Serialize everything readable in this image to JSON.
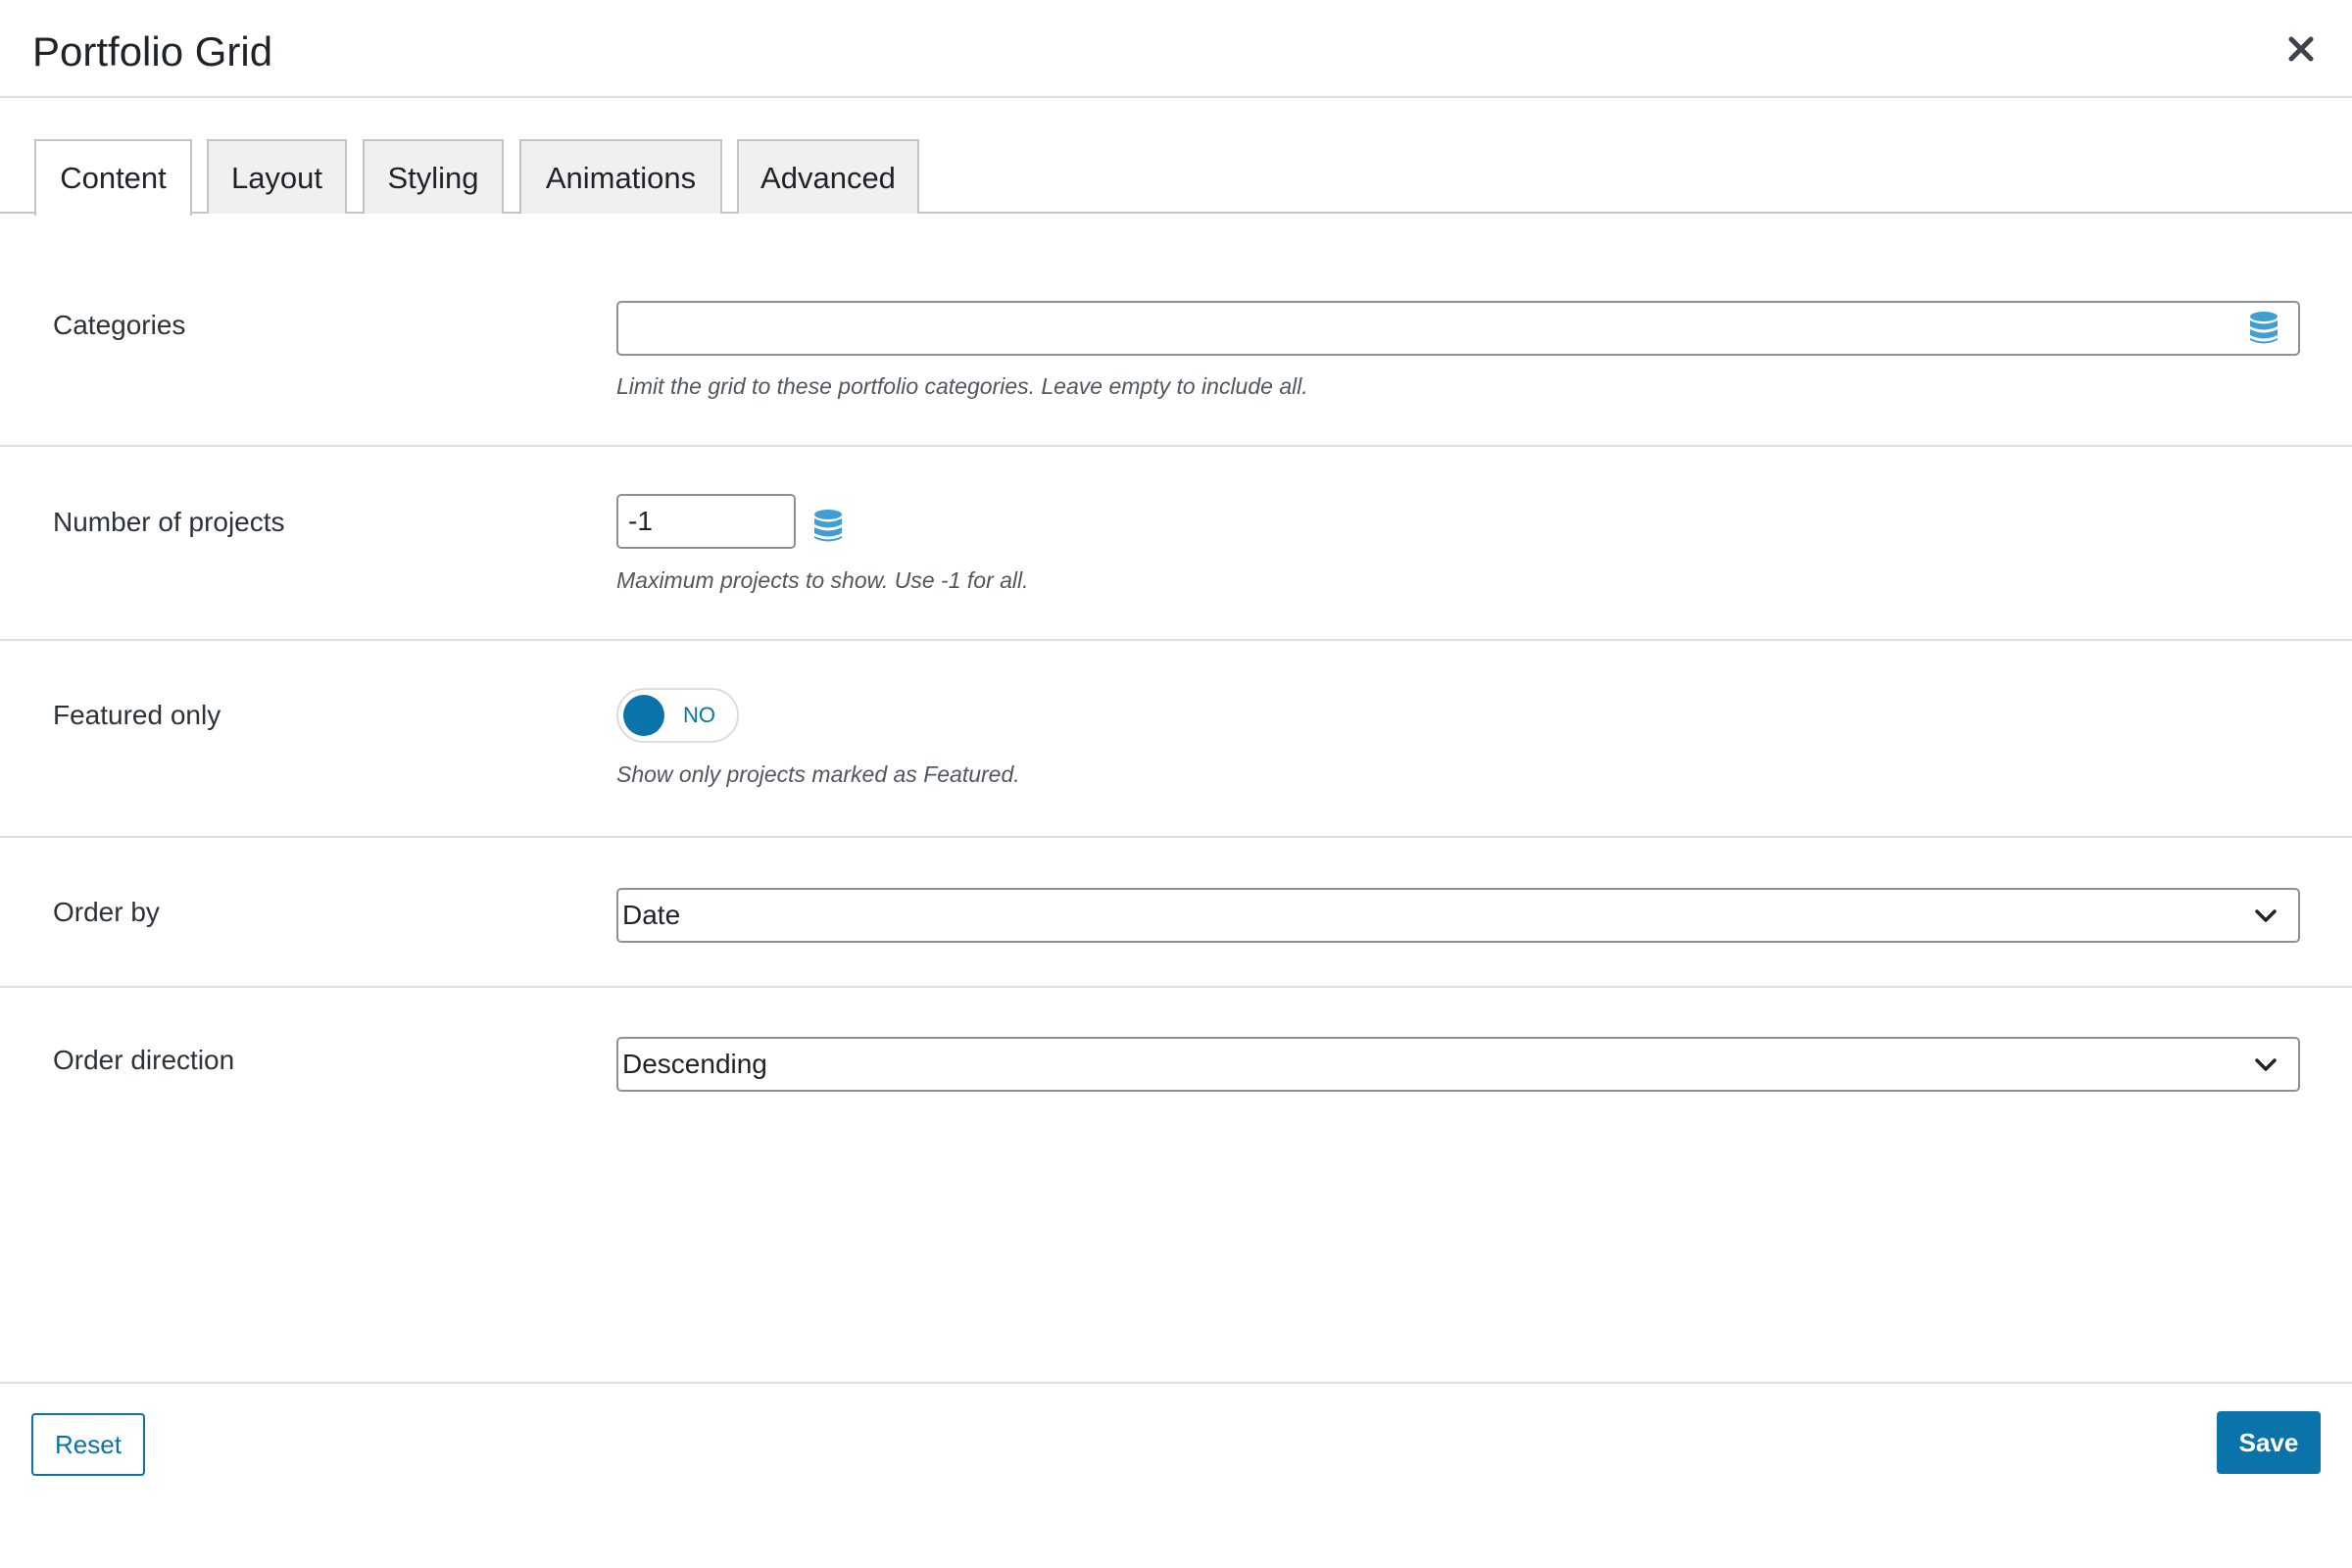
{
  "modal": {
    "title": "Portfolio Grid",
    "close_icon": "close-icon"
  },
  "tabs": [
    {
      "label": "Content",
      "active": true
    },
    {
      "label": "Layout",
      "active": false
    },
    {
      "label": "Styling",
      "active": false
    },
    {
      "label": "Animations",
      "active": false
    },
    {
      "label": "Advanced",
      "active": false
    }
  ],
  "fields": {
    "categories": {
      "label": "Categories",
      "value": "",
      "description": "Limit the grid to these portfolio categories. Leave empty to include all.",
      "icon": "database-icon"
    },
    "number_of_projects": {
      "label": "Number of projects",
      "value": "-1",
      "description": "Maximum projects to show. Use -1 for all.",
      "icon": "database-icon"
    },
    "featured_only": {
      "label": "Featured only",
      "toggle_text": "NO",
      "enabled": false,
      "description": "Show only projects marked as Featured."
    },
    "order_by": {
      "label": "Order by",
      "value": "Date",
      "icon": "chevron-down-icon"
    },
    "order_direction": {
      "label": "Order direction",
      "value": "Descending",
      "icon": "chevron-down-icon"
    }
  },
  "footer": {
    "reset_label": "Reset",
    "save_label": "Save"
  },
  "colors": {
    "accent": "#0a73aa",
    "icon_blue": "#3f9fd5",
    "border": "#8c8f94",
    "divider": "#dcdcde"
  }
}
